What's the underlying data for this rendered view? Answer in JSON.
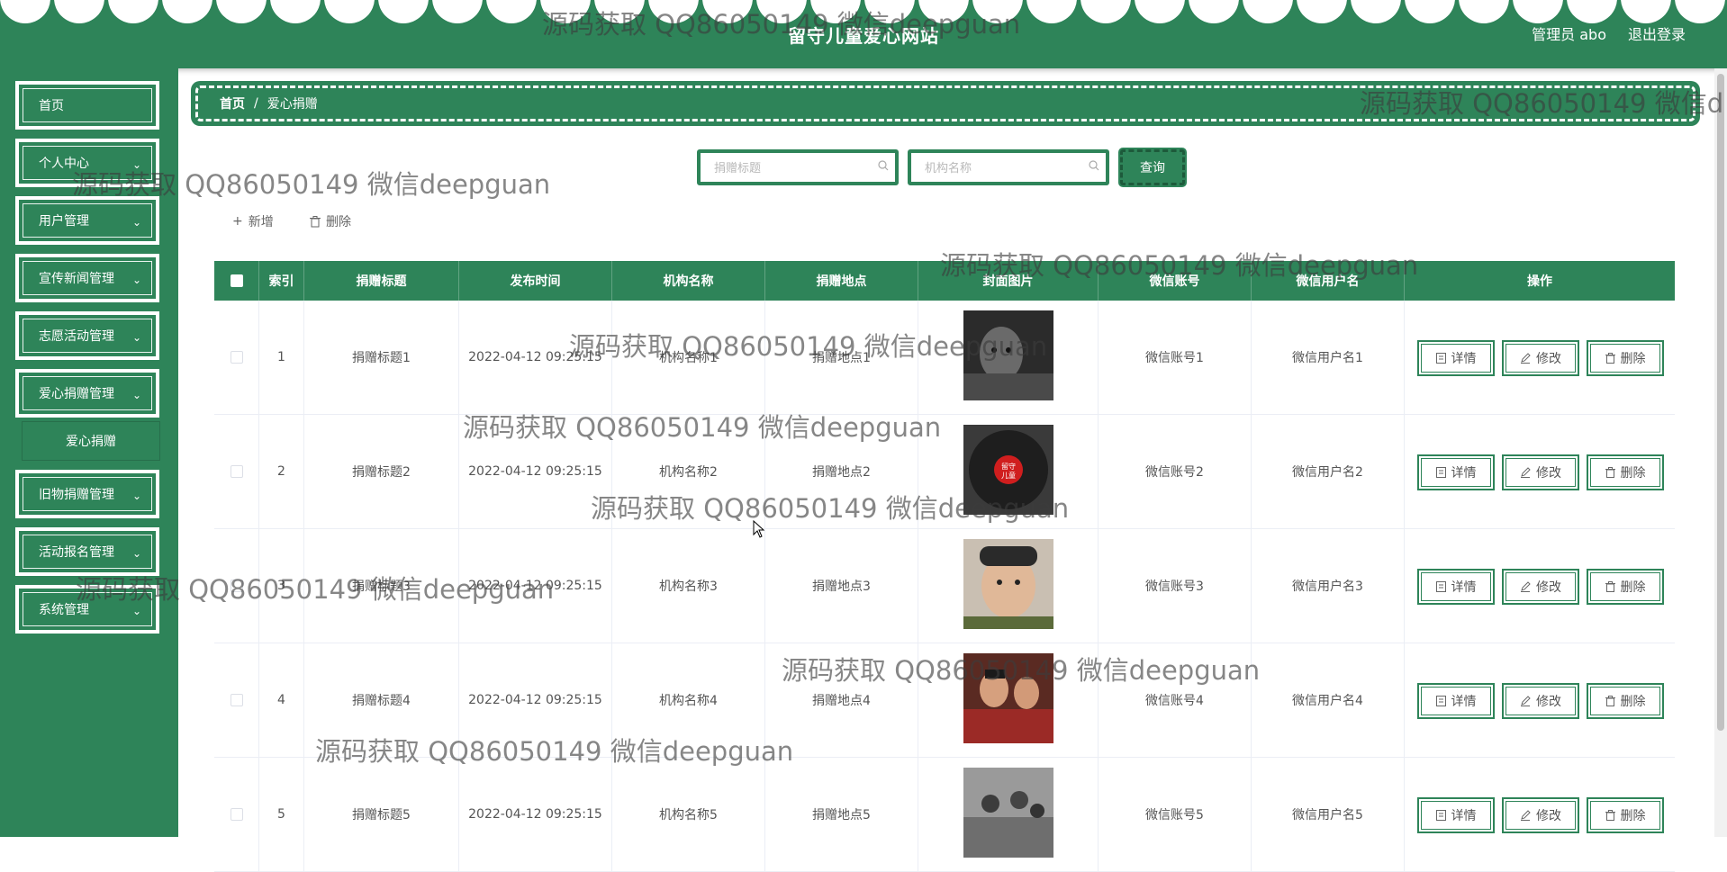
{
  "header": {
    "site_title": "留守儿童爱心网站",
    "user_label": "管理员 abo",
    "logout_label": "退出登录"
  },
  "sidebar": {
    "items": [
      {
        "label": "首页",
        "has_arrow": false
      },
      {
        "label": "个人中心",
        "has_arrow": true
      },
      {
        "label": "用户管理",
        "has_arrow": true
      },
      {
        "label": "宣传新闻管理",
        "has_arrow": true
      },
      {
        "label": "志愿活动管理",
        "has_arrow": true
      },
      {
        "label": "爱心捐赠管理",
        "has_arrow": true
      },
      {
        "label": "旧物捐赠管理",
        "has_arrow": true
      },
      {
        "label": "活动报名管理",
        "has_arrow": true
      },
      {
        "label": "系统管理",
        "has_arrow": true
      }
    ],
    "submenu": {
      "label": "爱心捐赠"
    }
  },
  "breadcrumb": {
    "home": "首页",
    "separator": "/",
    "current": "爱心捐赠"
  },
  "search": {
    "title_placeholder": "捐赠标题",
    "org_placeholder": "机构名称",
    "query_label": "查询"
  },
  "toolbar": {
    "add_label": "新增",
    "delete_label": "删除"
  },
  "table": {
    "columns": [
      "索引",
      "捐赠标题",
      "发布时间",
      "机构名称",
      "捐赠地点",
      "封面图片",
      "微信账号",
      "微信用户名",
      "操作"
    ],
    "rows": [
      {
        "index": "1",
        "title": "捐赠标题1",
        "time": "2022-04-12 09:25:15",
        "org": "机构名称1",
        "place": "捐赠地点1",
        "account": "微信账号1",
        "username": "微信用户名1"
      },
      {
        "index": "2",
        "title": "捐赠标题2",
        "time": "2022-04-12 09:25:15",
        "org": "机构名称2",
        "place": "捐赠地点2",
        "account": "微信账号2",
        "username": "微信用户名2"
      },
      {
        "index": "3",
        "title": "捐赠标题3",
        "time": "2022-04-12 09:25:15",
        "org": "机构名称3",
        "place": "捐赠地点3",
        "account": "微信账号3",
        "username": "微信用户名3"
      },
      {
        "index": "4",
        "title": "捐赠标题4",
        "time": "2022-04-12 09:25:15",
        "org": "机构名称4",
        "place": "捐赠地点4",
        "account": "微信账号4",
        "username": "微信用户名4"
      },
      {
        "index": "5",
        "title": "捐赠标题5",
        "time": "2022-04-12 09:25:15",
        "org": "机构名称5",
        "place": "捐赠地点5",
        "account": "微信账号5",
        "username": "微信用户名5"
      }
    ],
    "actions": {
      "detail": "详情",
      "edit": "修改",
      "delete": "删除"
    }
  },
  "watermark": {
    "text": "源码获取 QQ86050149 微信deepguan",
    "text_partial": "源码获取 QQ86050149 微信d"
  },
  "colors": {
    "primary": "#2e8459",
    "text": "#555555",
    "border": "#ebeef5"
  }
}
